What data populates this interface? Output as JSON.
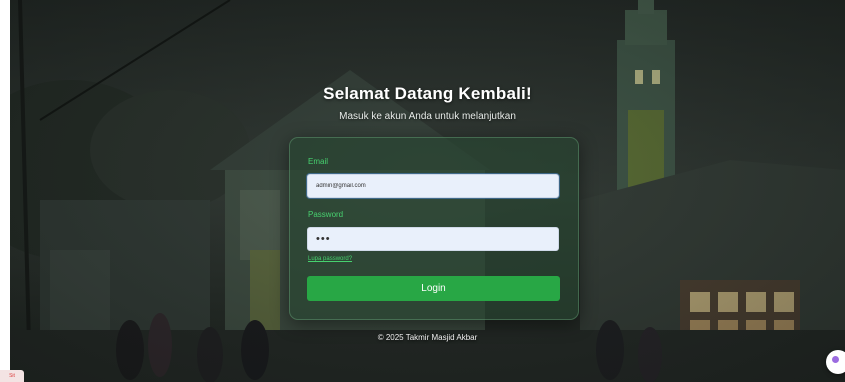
{
  "header": {
    "title": "Selamat Datang Kembali!",
    "subtitle": "Masuk ke akun Anda untuk melanjutkan"
  },
  "form": {
    "email_label": "Email",
    "email_value": "admin@gmail.com",
    "password_label": "Password",
    "password_value": "•••",
    "forgot_link": "Lupa password?",
    "login_button": "Login"
  },
  "footer": {
    "text": "© 2025 Takmir Masjid Akbar"
  },
  "corner_badge": "Sit",
  "colors": {
    "accent": "#28a745",
    "label_green": "#47d16f",
    "card_bg": "rgba(38,70,48,0.62)",
    "input_bg": "#e9f0fb",
    "floating_button_dot": "#9b6be0"
  },
  "icons": {
    "floating_button": "chat-bubble-icon"
  }
}
